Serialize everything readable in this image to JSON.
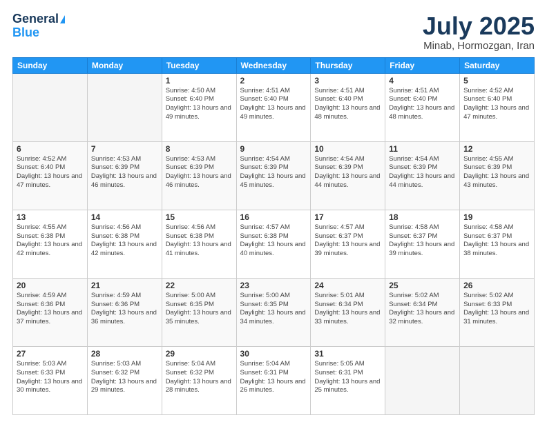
{
  "logo": {
    "line1": "General",
    "line2": "Blue"
  },
  "title": "July 2025",
  "subtitle": "Minab, Hormozgan, Iran",
  "weekdays": [
    "Sunday",
    "Monday",
    "Tuesday",
    "Wednesday",
    "Thursday",
    "Friday",
    "Saturday"
  ],
  "weeks": [
    [
      {
        "day": "",
        "info": ""
      },
      {
        "day": "",
        "info": ""
      },
      {
        "day": "1",
        "info": "Sunrise: 4:50 AM\nSunset: 6:40 PM\nDaylight: 13 hours and 49 minutes."
      },
      {
        "day": "2",
        "info": "Sunrise: 4:51 AM\nSunset: 6:40 PM\nDaylight: 13 hours and 49 minutes."
      },
      {
        "day": "3",
        "info": "Sunrise: 4:51 AM\nSunset: 6:40 PM\nDaylight: 13 hours and 48 minutes."
      },
      {
        "day": "4",
        "info": "Sunrise: 4:51 AM\nSunset: 6:40 PM\nDaylight: 13 hours and 48 minutes."
      },
      {
        "day": "5",
        "info": "Sunrise: 4:52 AM\nSunset: 6:40 PM\nDaylight: 13 hours and 47 minutes."
      }
    ],
    [
      {
        "day": "6",
        "info": "Sunrise: 4:52 AM\nSunset: 6:40 PM\nDaylight: 13 hours and 47 minutes."
      },
      {
        "day": "7",
        "info": "Sunrise: 4:53 AM\nSunset: 6:39 PM\nDaylight: 13 hours and 46 minutes."
      },
      {
        "day": "8",
        "info": "Sunrise: 4:53 AM\nSunset: 6:39 PM\nDaylight: 13 hours and 46 minutes."
      },
      {
        "day": "9",
        "info": "Sunrise: 4:54 AM\nSunset: 6:39 PM\nDaylight: 13 hours and 45 minutes."
      },
      {
        "day": "10",
        "info": "Sunrise: 4:54 AM\nSunset: 6:39 PM\nDaylight: 13 hours and 44 minutes."
      },
      {
        "day": "11",
        "info": "Sunrise: 4:54 AM\nSunset: 6:39 PM\nDaylight: 13 hours and 44 minutes."
      },
      {
        "day": "12",
        "info": "Sunrise: 4:55 AM\nSunset: 6:39 PM\nDaylight: 13 hours and 43 minutes."
      }
    ],
    [
      {
        "day": "13",
        "info": "Sunrise: 4:55 AM\nSunset: 6:38 PM\nDaylight: 13 hours and 42 minutes."
      },
      {
        "day": "14",
        "info": "Sunrise: 4:56 AM\nSunset: 6:38 PM\nDaylight: 13 hours and 42 minutes."
      },
      {
        "day": "15",
        "info": "Sunrise: 4:56 AM\nSunset: 6:38 PM\nDaylight: 13 hours and 41 minutes."
      },
      {
        "day": "16",
        "info": "Sunrise: 4:57 AM\nSunset: 6:38 PM\nDaylight: 13 hours and 40 minutes."
      },
      {
        "day": "17",
        "info": "Sunrise: 4:57 AM\nSunset: 6:37 PM\nDaylight: 13 hours and 39 minutes."
      },
      {
        "day": "18",
        "info": "Sunrise: 4:58 AM\nSunset: 6:37 PM\nDaylight: 13 hours and 39 minutes."
      },
      {
        "day": "19",
        "info": "Sunrise: 4:58 AM\nSunset: 6:37 PM\nDaylight: 13 hours and 38 minutes."
      }
    ],
    [
      {
        "day": "20",
        "info": "Sunrise: 4:59 AM\nSunset: 6:36 PM\nDaylight: 13 hours and 37 minutes."
      },
      {
        "day": "21",
        "info": "Sunrise: 4:59 AM\nSunset: 6:36 PM\nDaylight: 13 hours and 36 minutes."
      },
      {
        "day": "22",
        "info": "Sunrise: 5:00 AM\nSunset: 6:35 PM\nDaylight: 13 hours and 35 minutes."
      },
      {
        "day": "23",
        "info": "Sunrise: 5:00 AM\nSunset: 6:35 PM\nDaylight: 13 hours and 34 minutes."
      },
      {
        "day": "24",
        "info": "Sunrise: 5:01 AM\nSunset: 6:34 PM\nDaylight: 13 hours and 33 minutes."
      },
      {
        "day": "25",
        "info": "Sunrise: 5:02 AM\nSunset: 6:34 PM\nDaylight: 13 hours and 32 minutes."
      },
      {
        "day": "26",
        "info": "Sunrise: 5:02 AM\nSunset: 6:33 PM\nDaylight: 13 hours and 31 minutes."
      }
    ],
    [
      {
        "day": "27",
        "info": "Sunrise: 5:03 AM\nSunset: 6:33 PM\nDaylight: 13 hours and 30 minutes."
      },
      {
        "day": "28",
        "info": "Sunrise: 5:03 AM\nSunset: 6:32 PM\nDaylight: 13 hours and 29 minutes."
      },
      {
        "day": "29",
        "info": "Sunrise: 5:04 AM\nSunset: 6:32 PM\nDaylight: 13 hours and 28 minutes."
      },
      {
        "day": "30",
        "info": "Sunrise: 5:04 AM\nSunset: 6:31 PM\nDaylight: 13 hours and 26 minutes."
      },
      {
        "day": "31",
        "info": "Sunrise: 5:05 AM\nSunset: 6:31 PM\nDaylight: 13 hours and 25 minutes."
      },
      {
        "day": "",
        "info": ""
      },
      {
        "day": "",
        "info": ""
      }
    ]
  ]
}
